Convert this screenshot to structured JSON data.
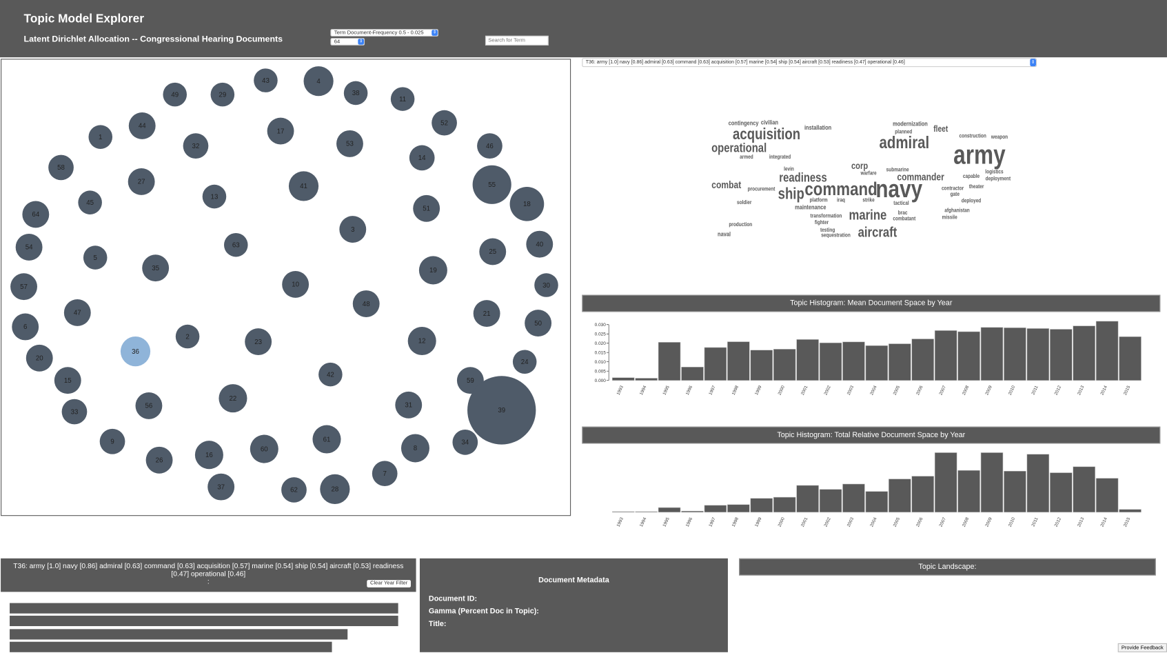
{
  "header": {
    "title": "Topic Model Explorer",
    "subtitle": "Latent Dirichlet Allocation -- Congressional Hearing Documents",
    "filter_select": "Term Document-Frequency 0.5 - 0.025",
    "topic_count_select": "64",
    "search_placeholder": "Search for Term"
  },
  "bubbles": {
    "topics": [
      49,
      29,
      43,
      4,
      38,
      11,
      52,
      46,
      44,
      1,
      32,
      17,
      53,
      14,
      58,
      27,
      55,
      18,
      41,
      13,
      45,
      51,
      64,
      3,
      63,
      54,
      5,
      25,
      40,
      35,
      19,
      10,
      57,
      30,
      48,
      47,
      21,
      50,
      6,
      2,
      23,
      12,
      36,
      20,
      24,
      42,
      59,
      15,
      39,
      22,
      56,
      31,
      33,
      9,
      26,
      16,
      60,
      61,
      8,
      34,
      7,
      37,
      62,
      28
    ],
    "selected_topic": 36,
    "color": "#4f5b69",
    "selected_color": "#8fb4d9"
  },
  "topic_select": "T36: army [1.0] navy [0.86] admiral [0.63] command [0.63] acquisition [0.57] marine [0.54] ship [0.54] aircraft [0.53] readiness [0.47] operational [0.46]",
  "word_cloud": [
    "contingency",
    "civilian",
    "acquisition",
    "installation",
    "operational",
    "armed",
    "integrated",
    "modernization",
    "planned",
    "fleet",
    "admiral",
    "construction",
    "weapon",
    "army",
    "corp",
    "levin",
    "warfare",
    "submarine",
    "readiness",
    "commander",
    "logistics",
    "capable",
    "deployment",
    "combat",
    "procurement",
    "ship",
    "command",
    "navy",
    "contractor",
    "theater",
    "gate",
    "platform",
    "iraq",
    "strike",
    "tactical",
    "deployed",
    "soldier",
    "maintenance",
    "afghanistan",
    "marine",
    "transformation",
    "brac",
    "combatant",
    "missile",
    "fighter",
    "production",
    "testing",
    "aircraft",
    "sequestration",
    "naval"
  ],
  "chart_data": [
    {
      "type": "bar",
      "title": "Topic Histogram: Mean Document Space by Year",
      "categories": [
        "1993",
        "1994",
        "1995",
        "1996",
        "1997",
        "1998",
        "1999",
        "2000",
        "2001",
        "2002",
        "2003",
        "2004",
        "2005",
        "2006",
        "2007",
        "2008",
        "2009",
        "2010",
        "2011",
        "2012",
        "2013",
        "2014",
        "2015"
      ],
      "values": [
        0.0015,
        0.0012,
        0.0205,
        0.0072,
        0.0177,
        0.0208,
        0.0163,
        0.0168,
        0.022,
        0.0202,
        0.0207,
        0.0187,
        0.0197,
        0.0223,
        0.0268,
        0.0262,
        0.0285,
        0.0283,
        0.0279,
        0.0275,
        0.0293,
        0.0318,
        0.0235
      ],
      "yticks": [
        "0.000",
        "0.005",
        "0.010",
        "0.015",
        "0.020",
        "0.025",
        "0.030"
      ],
      "ylim": [
        0,
        0.032
      ],
      "color": "#595959"
    },
    {
      "type": "bar",
      "title": "Topic Histogram: Total Relative Document Space by Year",
      "categories": [
        "1993",
        "1994",
        "1995",
        "1996",
        "1997",
        "1998",
        "1999",
        "2000",
        "2001",
        "2002",
        "2003",
        "2004",
        "2005",
        "2006",
        "2007",
        "2008",
        "2009",
        "2010",
        "2011",
        "2012",
        "2013",
        "2014",
        "2015"
      ],
      "values": [
        0.003,
        0.003,
        0.078,
        0.019,
        0.116,
        0.128,
        0.233,
        0.252,
        0.45,
        0.384,
        0.473,
        0.349,
        0.558,
        0.605,
        1.0,
        0.702,
        1.0,
        0.69,
        0.973,
        0.663,
        0.764,
        0.57,
        0.047
      ],
      "ylim": [
        0,
        1
      ],
      "color": "#595959"
    }
  ],
  "topic_docs": {
    "header_text": "T36: army [1.0] navy [0.86] admiral [0.63] command [0.63] acquisition [0.57] marine [0.54] ship [0.54] aircraft [0.53] readiness [0.47] operational [0.46]",
    "sub_text": ":",
    "clear_button": "Clear Year Filter",
    "bar_fractions": [
      1.0,
      1.0,
      0.87,
      0.83
    ]
  },
  "metadata": {
    "title": "Document Metadata",
    "doc_id_label": "Document ID:",
    "gamma_label": "Gamma (Percent Doc in Topic):",
    "title_label": "Title:"
  },
  "landscape": {
    "title": "Topic Landscape:"
  },
  "feedback_button": "Provide Feedback"
}
